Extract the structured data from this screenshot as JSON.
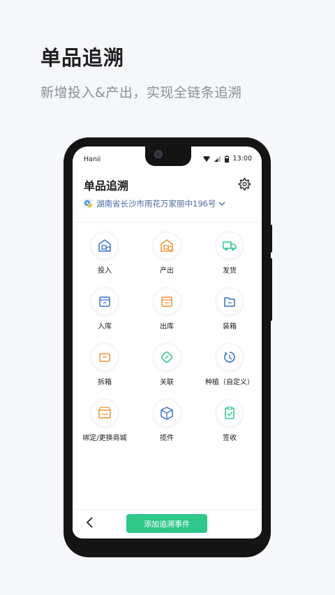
{
  "promo": {
    "title": "单品追溯",
    "subtitle": "新增投入&产出，实现全链条追溯"
  },
  "status_bar": {
    "carrier": "Hanii",
    "time": "13:00"
  },
  "app": {
    "title": "单品追溯",
    "location": "湖南省长沙市雨花万家丽中196号"
  },
  "actions": [
    {
      "label": "投入",
      "icon": "warehouse-in-icon",
      "color": "#3b6fd6"
    },
    {
      "label": "产出",
      "icon": "warehouse-out-icon",
      "color": "#f0912f"
    },
    {
      "label": "发货",
      "icon": "truck-icon",
      "color": "#2ec88a"
    },
    {
      "label": "入库",
      "icon": "inbound-box-icon",
      "color": "#3b6fd6"
    },
    {
      "label": "出库",
      "icon": "outbound-box-icon",
      "color": "#f0912f"
    },
    {
      "label": "装箱",
      "icon": "pack-box-icon",
      "color": "#3b6fd6"
    },
    {
      "label": "拆箱",
      "icon": "unpack-box-icon",
      "color": "#f0912f"
    },
    {
      "label": "关联",
      "icon": "link-icon",
      "color": "#2ec88a"
    },
    {
      "label": "种植（自定义）",
      "icon": "plant-cycle-icon",
      "color": "#3b6fd6"
    },
    {
      "label": "绑定/更换商城",
      "icon": "store-bind-icon",
      "color": "#f0912f"
    },
    {
      "label": "揽件",
      "icon": "parcel-icon",
      "color": "#3b6fd6"
    },
    {
      "label": "签收",
      "icon": "clipboard-check-icon",
      "color": "#2ec88a"
    }
  ],
  "bottom": {
    "add_button": "添加追溯事件"
  },
  "colors": {
    "accent_green": "#2ec88a",
    "accent_blue": "#3b6fd6",
    "accent_orange": "#f0912f"
  }
}
